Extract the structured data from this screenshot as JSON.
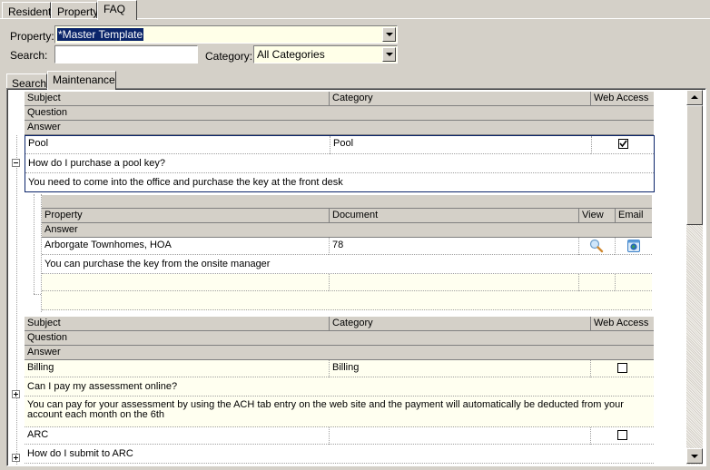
{
  "top_tabs": [
    {
      "label": "Resident",
      "active": false
    },
    {
      "label": "Property",
      "active": false
    },
    {
      "label": "FAQ",
      "active": true
    }
  ],
  "filters": {
    "property_label": "Property:",
    "property_value": "*Master Template",
    "search_label": "Search:",
    "search_value": "",
    "category_label": "Category:",
    "category_value": "All Categories"
  },
  "sub_tabs": [
    {
      "label": "Search",
      "active": false
    },
    {
      "label": "Maintenance",
      "active": true
    }
  ],
  "grid": {
    "headers": {
      "subject": "Subject",
      "category": "Category",
      "web_access": "Web Access",
      "question": "Question",
      "answer": "Answer"
    },
    "rows": [
      {
        "subject": "Pool",
        "category": "Pool",
        "web_access": true,
        "question": "How do I purchase a pool key?",
        "answer": "You need to come into the office and purchase the key at the front desk",
        "expanded": true,
        "child": {
          "headers": {
            "property": "Property",
            "document": "Document",
            "view": "View",
            "email": "Email",
            "answer": "Answer"
          },
          "rows": [
            {
              "property": "Arborgate Townhomes, HOA",
              "document": "78",
              "view_icon": "magnifier-icon",
              "email_icon": "globe-email-icon",
              "answer": "You can purchase the key from the onsite manager"
            }
          ]
        }
      },
      {
        "subject": "Billing",
        "category": "Billing",
        "web_access": false,
        "question": "Can I pay my assessment online?",
        "answer": "You can pay for your assessment by using the ACH tab entry on the web site and the payment will automatically be deducted from your account each month on the 6th",
        "expanded": false
      },
      {
        "subject": "ARC",
        "category": "",
        "web_access": false,
        "question": "How do I submit to ARC",
        "expanded": false
      }
    ]
  },
  "scrollbar": {
    "position_fraction": 0.0,
    "visible_fraction": 0.35
  }
}
